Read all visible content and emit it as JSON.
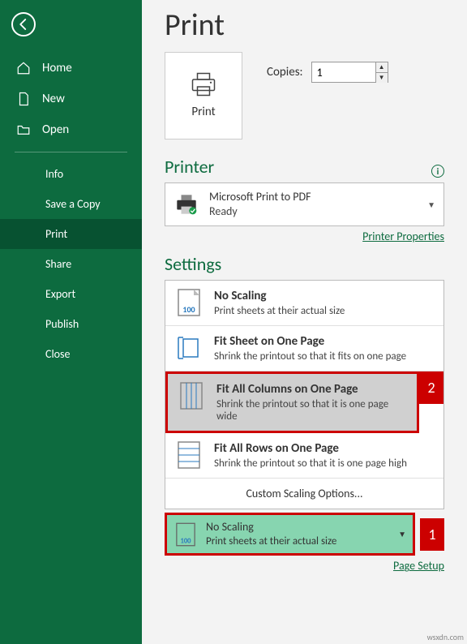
{
  "sidebar": {
    "home": "Home",
    "new": "New",
    "open": "Open",
    "info": "Info",
    "saveCopy": "Save a Copy",
    "print": "Print",
    "share": "Share",
    "export": "Export",
    "publish": "Publish",
    "close": "Close"
  },
  "main": {
    "title": "Print",
    "printButton": "Print",
    "copiesLabel": "Copies:",
    "copiesValue": "1",
    "printer": {
      "heading": "Printer",
      "name": "Microsoft Print to PDF",
      "status": "Ready",
      "propsLink": "Printer Properties"
    },
    "settings": {
      "heading": "Settings",
      "options": [
        {
          "title": "No Scaling",
          "sub": "Print sheets at their actual size"
        },
        {
          "title": "Fit Sheet on One Page",
          "sub": "Shrink the printout so that it fits on one page"
        },
        {
          "title": "Fit All Columns on One Page",
          "sub": "Shrink the printout so that it is one page wide"
        },
        {
          "title": "Fit All Rows on One Page",
          "sub": "Shrink the printout so that it is one page high"
        }
      ],
      "custom": "Custom Scaling Options...",
      "selected": {
        "title": "No Scaling",
        "sub": "Print sheets at their actual size"
      },
      "pageSetup": "Page Setup"
    },
    "callout1": "1",
    "callout2": "2"
  },
  "watermark": "wsxdn.com"
}
